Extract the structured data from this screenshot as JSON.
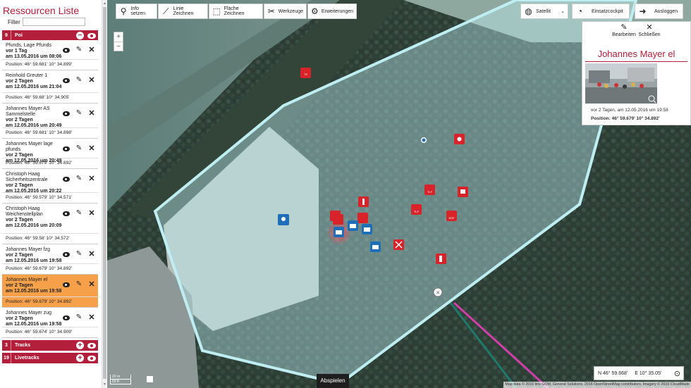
{
  "sidebar": {
    "title": "Ressourcen Liste",
    "filter_label": "Filter",
    "filter_value": "",
    "sections": {
      "poi": {
        "count": "9",
        "title": "Poi",
        "toggle": "−"
      },
      "tracks": {
        "count": "3",
        "title": "Tracks",
        "toggle": "+"
      },
      "livetracks": {
        "count": "19",
        "title": "Livetracks",
        "toggle": "+"
      }
    },
    "poi_items": [
      {
        "name": "Pfunds, Lage Pfunds",
        "ago": "vor 1 Tag",
        "date": "am 13.05.2016 um 08:06",
        "position": "Position: 46° 59.681' 10° 34.899'"
      },
      {
        "name": "Reinhold Greuter 1",
        "ago": "vor 2 Tagen",
        "date": "am 12.05.2016 um 21:04",
        "position": "Position: 46° 59.68' 10° 34.905'"
      },
      {
        "name": "Johannes Mayer AS Sammelstelle",
        "ago": "vor 2 Tagen",
        "date": "am 12.05.2016 um 20:49",
        "position": "Position: 46° 59.681' 10° 34.898'"
      },
      {
        "name": "Johannes Mayer lage pfunds",
        "ago": "vor 2 Tagen",
        "date": "am 12.05.2016 um 20:49",
        "position": "Position: 46° 59.679' 10° 34.892'"
      },
      {
        "name": "Christoph Haag Sicherheitszentrale",
        "ago": "vor 2 Tagen",
        "date": "am 12.05.2016 um 20:22",
        "position": "Position: 46° 59.579' 10° 34.571'"
      },
      {
        "name": "Christoph Haag Weichenstellplan",
        "ago": "vor 2 Tagen",
        "date": "am 12.05.2016 um 20:09",
        "position": "Position: 46° 59.58' 10° 34.572'"
      },
      {
        "name": "Johannes Mayer fzg",
        "ago": "vor 2 Tagen",
        "date": "am 12.05.2016 um 19:58",
        "position": "Position: 46° 59.679' 10° 34.892'"
      },
      {
        "name": "Johannes Mayer el",
        "ago": "vor 2 Tagen",
        "date": "am 12.05.2016 um 19:58",
        "position": "Position: 46° 59.679' 10° 34.892'"
      },
      {
        "name": "Johannes Mayer zug",
        "ago": "vor 2 Tagen",
        "date": "am 12.05.2016 um 19:58",
        "position": "Position: 46° 59.674' 10° 34.909'"
      }
    ]
  },
  "toolbar": {
    "info": "Info setzen",
    "line": "Linie Zeichnen",
    "area": "Fläche Zeichnen",
    "tools": "Werkzeuge",
    "extensions": "Erweiterungen",
    "layer": "Satellit",
    "cockpit": "Einsatzcockpit",
    "logout": "Ausloggen"
  },
  "zoom": {
    "in": "+",
    "out": "−"
  },
  "info_panel": {
    "edit": "Bearbeiten",
    "close": "Schließen",
    "title": "Johannes Mayer el",
    "ago": "vor 2 Tagen, am 12.05.2016 um 19:58",
    "position": "Position: 46° 59.679' 10° 34.892'"
  },
  "coords": {
    "lat": "N 46° 59.668'",
    "lon": "E 10° 35.05'"
  },
  "play_label": "Abspielen",
  "scale": {
    "top": "20 m",
    "bottom": "50 ft"
  },
  "attribution": "Map data © 2016 tiris GOM, General Solutions, 2016 OpenStreetMap contributors, Imagery © 2016 CloudMade",
  "map_markers": {
    "tlf": "TLF",
    "kdf": "KDF",
    "ts": "TS",
    "hb": "HB"
  },
  "colors": {
    "brand": "#b31f3a",
    "active_row": "#f7a04a",
    "polygon": "#bfeef2",
    "blue_marker": "#1f6fb8"
  }
}
